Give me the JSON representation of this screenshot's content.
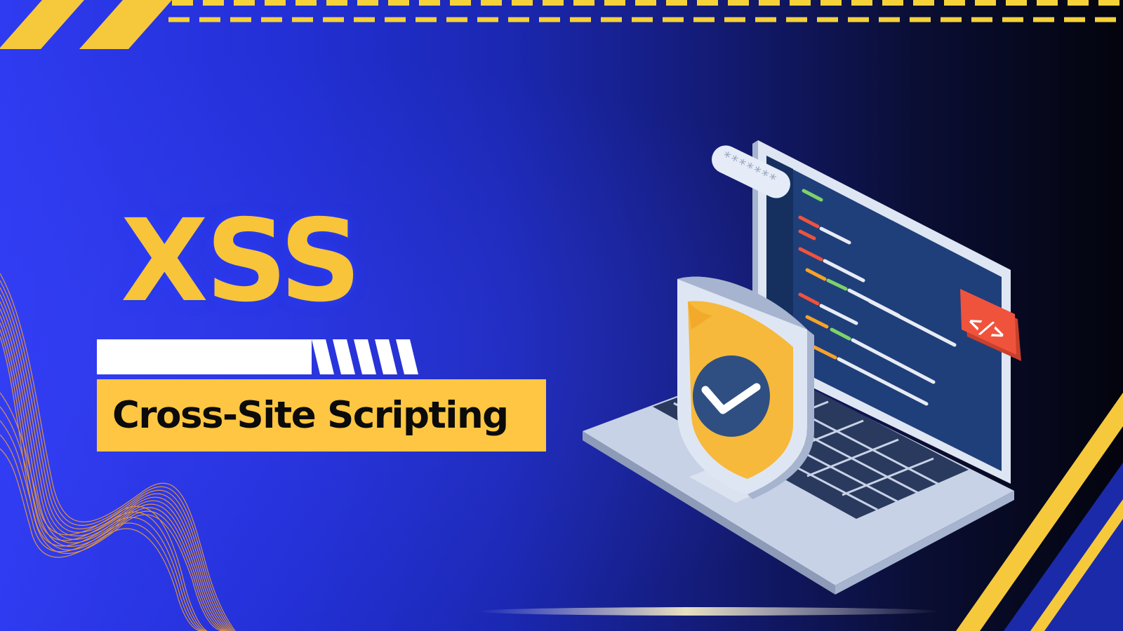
{
  "title": "XSS",
  "subtitle": "Cross-Site Scripting",
  "password_mask": "*******",
  "code_badge": "</>",
  "colors": {
    "accent_yellow": "#fec642",
    "brand_blue": "#2f3bf0",
    "dark": "#03040d",
    "shield_gold": "#f6b93b",
    "badge_red": "#f0533c"
  },
  "icons": [
    "shield-check-icon",
    "laptop-icon",
    "password-field-icon",
    "code-tag-icon"
  ]
}
